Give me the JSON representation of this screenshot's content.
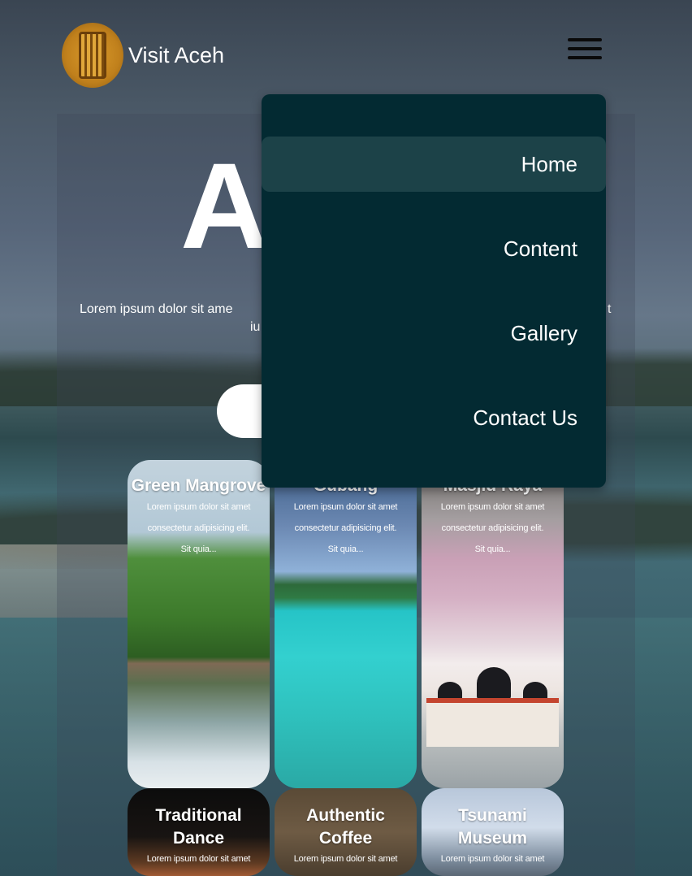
{
  "header": {
    "brand": "Visit Aceh",
    "logo_icon": "aceh-emblem-icon",
    "menu_icon": "hamburger-menu-icon"
  },
  "hero": {
    "title_visible": "A",
    "description_part1": "Lorem ipsum dolor sit ame",
    "description_part2": "iu",
    "description_part3": "t"
  },
  "menu": {
    "items": [
      {
        "label": "Home",
        "active": true
      },
      {
        "label": "Content",
        "active": false
      },
      {
        "label": "Gallery",
        "active": false
      },
      {
        "label": "Contact Us",
        "active": false
      }
    ]
  },
  "cards": [
    {
      "title": "Green Mangrove",
      "desc1": "Lorem ipsum dolor sit amet",
      "desc2": "consectetur adipisicing elit.",
      "desc3": "Sit quia..."
    },
    {
      "title": "Gubang",
      "desc1": "Lorem ipsum dolor sit amet",
      "desc2": "consectetur adipisicing elit.",
      "desc3": "Sit quia..."
    },
    {
      "title": "Masjid Raya",
      "desc1": "Lorem ipsum dolor sit amet",
      "desc2": "consectetur adipisicing elit.",
      "desc3": "Sit quia..."
    },
    {
      "title_line1": "Traditional",
      "title_line2": "Dance",
      "desc1": "Lorem ipsum dolor sit amet"
    },
    {
      "title_line1": "Authentic",
      "title_line2": "Coffee",
      "desc1": "Lorem ipsum dolor sit amet"
    },
    {
      "title_line1": "Tsunami",
      "title_line2": "Museum",
      "desc1": "Lorem ipsum dolor sit amet"
    }
  ],
  "colors": {
    "menu_bg": "#032a32",
    "menu_active": "#1c4248"
  }
}
